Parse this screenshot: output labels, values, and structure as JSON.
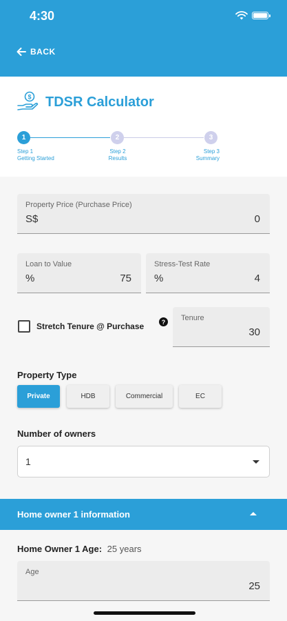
{
  "status_bar": {
    "time": "4:30"
  },
  "nav": {
    "back_label": "BACK"
  },
  "header": {
    "title": "TDSR Calculator"
  },
  "stepper": {
    "steps": [
      {
        "number": "1",
        "label_line1": "Step 1",
        "label_line2": "Getting Started"
      },
      {
        "number": "2",
        "label_line1": "Step 2",
        "label_line2": "Results"
      },
      {
        "number": "3",
        "label_line1": "Step 3",
        "label_line2": "Summary"
      }
    ]
  },
  "form": {
    "property_price": {
      "label": "Property Price (Purchase Price)",
      "prefix": "S$",
      "value": "0"
    },
    "loan_to_value": {
      "label": "Loan to Value",
      "prefix": "%",
      "value": "75"
    },
    "stress_test_rate": {
      "label": "Stress-Test Rate",
      "prefix": "%",
      "value": "4"
    },
    "stretch_tenure": {
      "label": "Stretch Tenure @ Purchase",
      "checked": false,
      "help_glyph": "?"
    },
    "tenure": {
      "label": "Tenure",
      "value": "30"
    },
    "property_type": {
      "label": "Property Type",
      "options": [
        "Private",
        "HDB",
        "Commercial",
        "EC"
      ],
      "selected": "Private"
    },
    "number_of_owners": {
      "label": "Number of owners",
      "value": "1"
    }
  },
  "owner_section": {
    "title": "Home owner 1 information",
    "age_label": "Home Owner 1 Age:",
    "age_value": "25 years",
    "age_field": {
      "label": "Age",
      "value": "25"
    }
  },
  "colors": {
    "accent": "#2b9fd8",
    "inactive_step": "#cfd0ec",
    "field_bg": "#ececec",
    "form_bg": "#f6f6f6"
  }
}
